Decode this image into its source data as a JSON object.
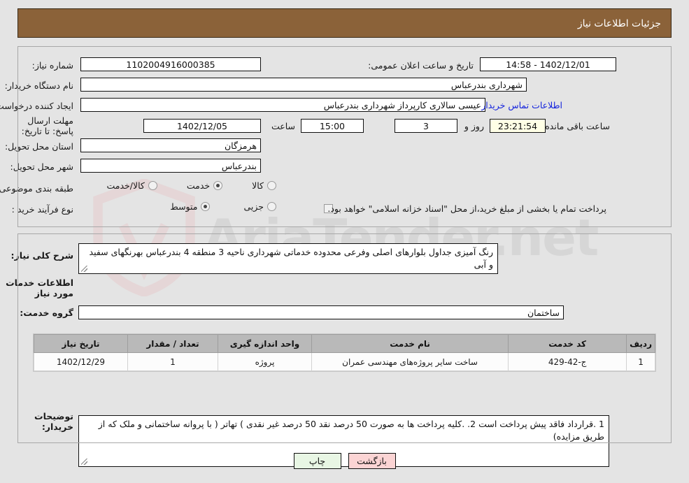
{
  "header": {
    "title": "جزئیات اطلاعات نیاز"
  },
  "watermark": {
    "text": "AriaTender.net",
    "shield_icon": "shield-icon"
  },
  "top_section": {
    "need_number": {
      "label": "شماره نیاز:",
      "value": "1102004916000385"
    },
    "announce_datetime": {
      "label": "تاریخ و ساعت اعلان عمومی:",
      "value": "1402/12/01 - 14:58"
    },
    "buyer_org": {
      "label": "نام دستگاه خریدار:",
      "value": "شهرداری بندرعباس"
    },
    "requester": {
      "label": "ایجاد کننده درخواست:",
      "value": "عیسی سالاری کارپرداز شهرداری بندرعباس"
    },
    "contact_link": {
      "label": "اطلاعات تماس خریدار"
    },
    "deadline": {
      "label": "مهلت ارسال پاسخ: تا تاریخ:",
      "date": "1402/12/05",
      "hour_label": "ساعت",
      "hour": "15:00",
      "days": "3",
      "days_label": "روز و",
      "timer": "23:21:54",
      "timer_label": "ساعت باقی مانده"
    },
    "delivery_province": {
      "label": "استان محل تحویل:",
      "value": "هرمزگان"
    },
    "delivery_city": {
      "label": "شهر محل تحویل:",
      "value": "بندرعباس"
    },
    "category": {
      "label": "طبقه بندی موضوعی:",
      "options": [
        {
          "label": "کالا",
          "selected": false
        },
        {
          "label": "خدمت",
          "selected": true
        },
        {
          "label": "کالا/خدمت",
          "selected": false
        }
      ]
    },
    "purchase_type": {
      "label": "نوع فرآیند خرید :",
      "options": [
        {
          "label": "جزیی",
          "selected": false
        },
        {
          "label": "متوسط",
          "selected": true
        }
      ]
    },
    "treasury_note": {
      "checked": false,
      "text": "پرداخت تمام یا بخشی از مبلغ خرید،از محل \"اسناد خزانه اسلامی\" خواهد بود."
    }
  },
  "bottom_section": {
    "general_desc": {
      "label": "شرح کلی نیاز:",
      "value": "رنگ آمیزی جداول بلوارهای اصلی وفرعی محدوده خدماتی شهرداری ناحیه 3 منطقه 4 بندرعباس بهرنگهای سفید و آبی"
    },
    "services_heading": "اطلاعات خدمات مورد نیاز",
    "service_group": {
      "label": "گروه خدمت:",
      "value": "ساختمان"
    },
    "table": {
      "columns": [
        "ردیف",
        "کد خدمت",
        "نام خدمت",
        "واحد اندازه گیری",
        "تعداد / مقدار",
        "تاریخ نیاز"
      ],
      "rows": [
        {
          "row": "1",
          "service_code": "ج-42-429",
          "service_name": "ساخت سایر پروژه‌های مهندسی عمران",
          "unit": "پروژه",
          "quantity": "1",
          "need_date": "1402/12/29"
        }
      ]
    },
    "buyer_notes": {
      "label": "توضیحات خریدار:",
      "value": "1 .قرارداد فاقد پیش پرداخت است 2. .کلیه پرداخت ها به صورت 50 درصد نقد 50 درصد غیر نقدی ) تهاتر ( با پروانه ساختمانی و ملک که از طریق مزایده)"
    }
  },
  "buttons": {
    "print": "چاپ",
    "back": "بازگشت"
  },
  "colors": {
    "header_bg": "#8b6239",
    "link": "#1423dd",
    "timer_bg": "#ffffe6",
    "print_bg": "#e8f6e4",
    "back_bg": "#fbd4d4",
    "table_header_bg": "#b9b9b9",
    "page_bg": "#e4e4e4"
  }
}
